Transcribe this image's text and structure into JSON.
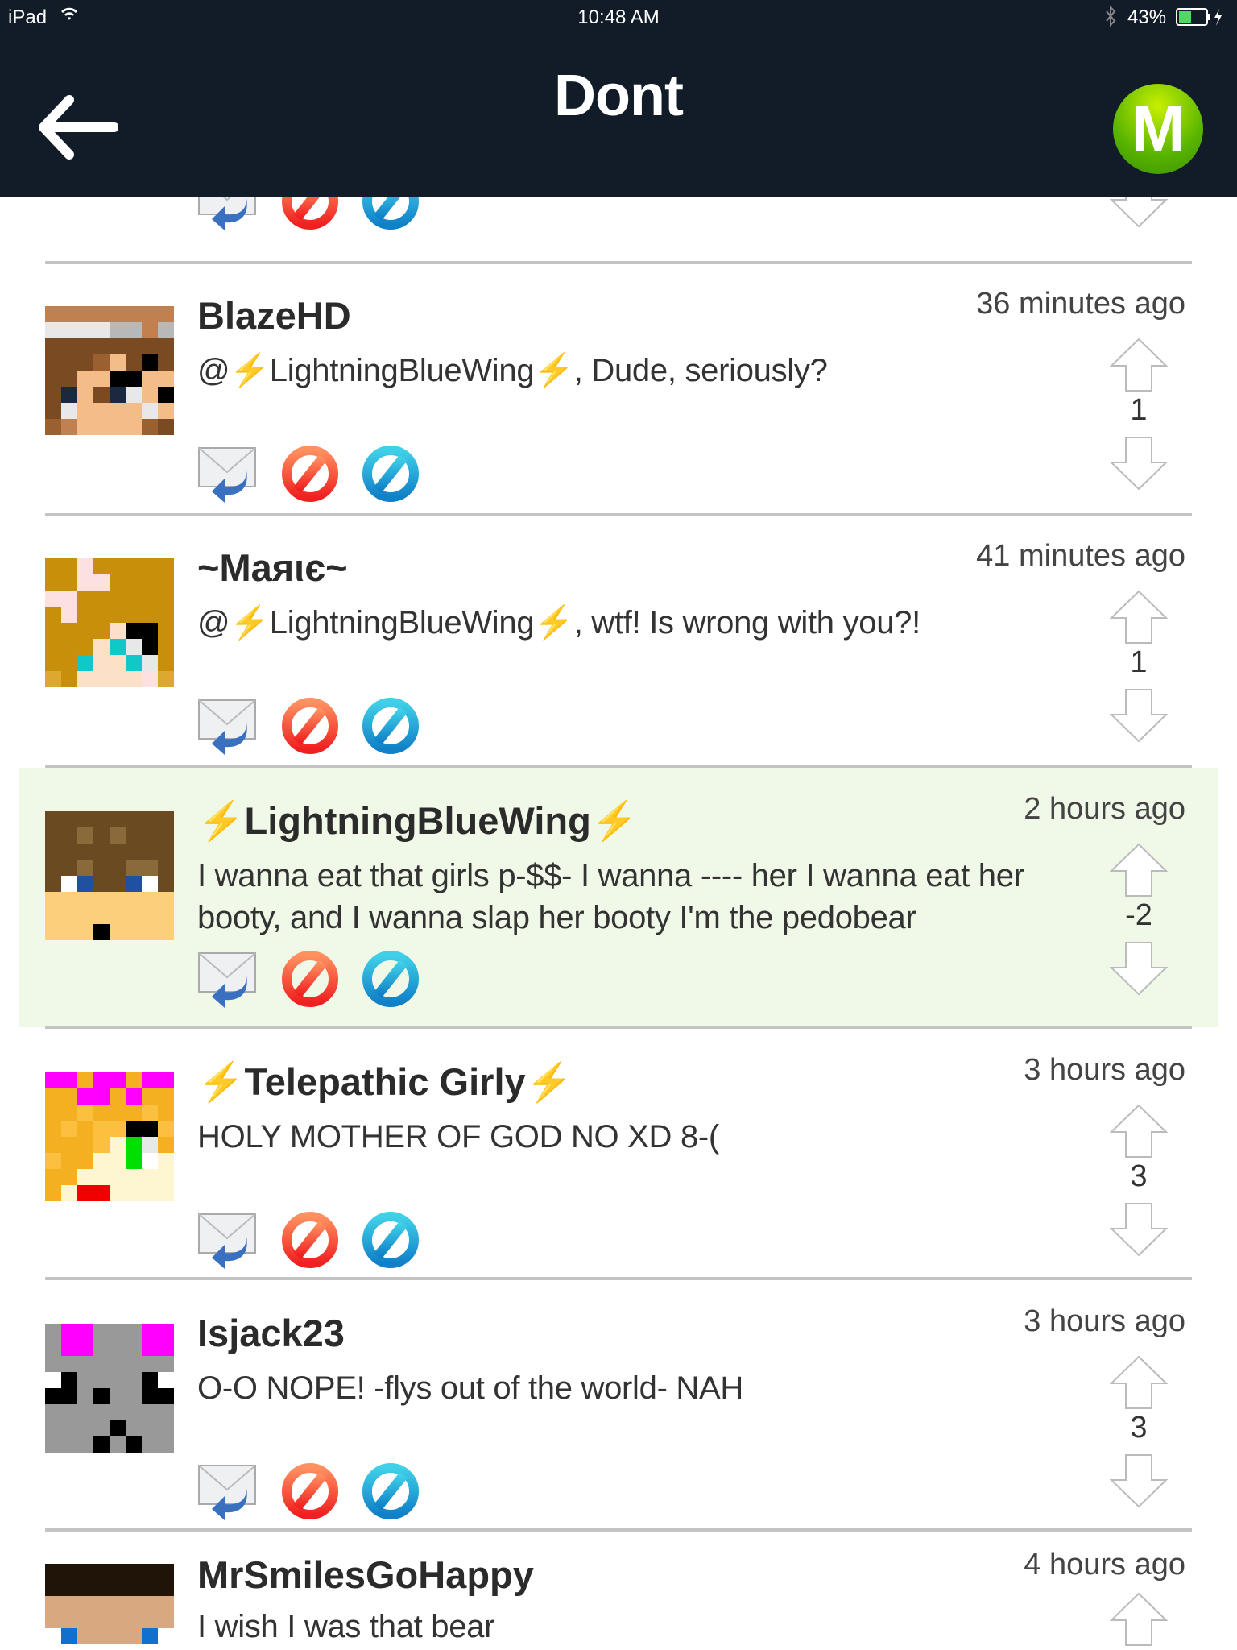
{
  "status_bar": {
    "device": "iPad",
    "time": "10:48 AM",
    "battery": "43%"
  },
  "header": {
    "title": "Dont",
    "logo_letter": "M"
  },
  "comments": [
    {
      "name": "BlazeHD",
      "time": "36 minutes ago",
      "text": "@⚡LightningBlueWing⚡, Dude, seriously?",
      "score": "1"
    },
    {
      "name": "~Maяιє~",
      "time": "41 minutes ago",
      "text": "@⚡LightningBlueWing⚡, wtf! Is wrong with you?!",
      "score": "1"
    },
    {
      "name": "⚡LightningBlueWing⚡",
      "time": "2 hours ago",
      "text": "I wanna eat that girls p-$$- I wanna ---- her I wanna eat her booty, and I wanna slap her booty I'm the pedobear",
      "score": "-2",
      "highlighted": true
    },
    {
      "name": "⚡Telepathic Girly⚡",
      "time": "3 hours ago",
      "text": "HOLY MOTHER OF GOD NO XD 8-(",
      "score": "3"
    },
    {
      "name": "Isjack23",
      "time": "3 hours ago",
      "text": "O-O NOPE! -flys out of the world- NAH",
      "score": "3"
    },
    {
      "name": "MrSmilesGoHappy",
      "time": "4 hours ago",
      "text": "I wish I was that bear",
      "score": ""
    }
  ],
  "colors": {
    "nav_bg": "#121c29",
    "highlight_bg": "#f0f8e7",
    "logo_green": "#58b400",
    "report_red": "#f03a2a",
    "block_blue": "#1aa0d8"
  }
}
